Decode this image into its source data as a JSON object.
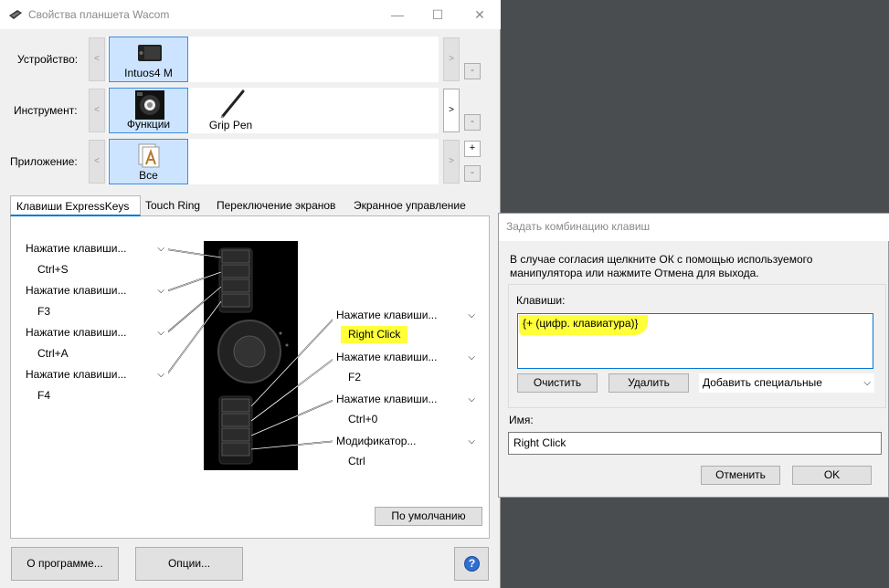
{
  "window": {
    "title": "Свойства планшета Wacom",
    "minimize": "—",
    "maximize": "☐",
    "close": "✕"
  },
  "device": {
    "label": "Устройство:",
    "items": [
      "Intuos4 M"
    ],
    "prev": "<",
    "next": ">",
    "remove": "-"
  },
  "tool": {
    "label": "Инструмент:",
    "items": [
      "Функции",
      "Grip Pen"
    ],
    "prev": "<",
    "next": ">",
    "remove": "-"
  },
  "application": {
    "label": "Приложение:",
    "items": [
      "Все"
    ],
    "prev": "<",
    "next": ">",
    "add": "+",
    "remove": "-"
  },
  "tabs": [
    "Клавиши ExpressKeys",
    "Touch Ring",
    "Переключение экранов",
    "Экранное управление"
  ],
  "expresskeys": {
    "left": [
      {
        "action": "Нажатие клавиши...",
        "value": "Ctrl+S"
      },
      {
        "action": "Нажатие клавиши...",
        "value": "F3"
      },
      {
        "action": "Нажатие клавиши...",
        "value": "Ctrl+A"
      },
      {
        "action": "Нажатие клавиши...",
        "value": "F4"
      }
    ],
    "right": [
      {
        "action": "Нажатие клавиши...",
        "value": "Right Click"
      },
      {
        "action": "Нажатие клавиши...",
        "value": "F2"
      },
      {
        "action": "Нажатие клавиши...",
        "value": "Ctrl+0"
      },
      {
        "action": "Модификатор...",
        "value": "Ctrl"
      }
    ],
    "default_button": "По умолчанию"
  },
  "footer": {
    "about": "О программе...",
    "options": "Опции...",
    "help": "?"
  },
  "dialog": {
    "title": "Задать комбинацию клавиш",
    "instructions": "В случае согласия щелкните ОК с помощью используемого манипулятора или нажмите Отмена для выхода.",
    "keys_label": "Клавиши:",
    "keys_value": "{+ (цифр. клавиатура)}",
    "clear": "Очистить",
    "delete": "Удалить",
    "add_special": "Добавить специальные",
    "name_label": "Имя:",
    "name_value": "Right Click",
    "cancel": "Отменить",
    "ok": "OK"
  },
  "colors": {
    "accent": "#0078d7",
    "highlight": "#ffff3a",
    "selection": "#cce4ff",
    "desktop": "#4a4d50"
  }
}
